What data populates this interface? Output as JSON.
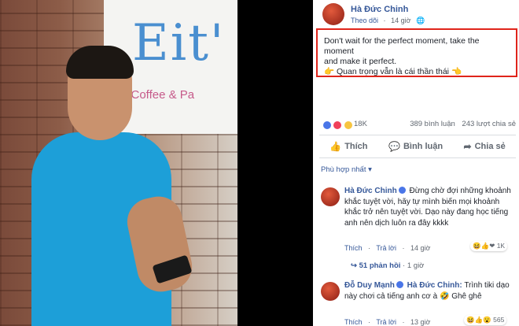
{
  "photo": {
    "sign_title": "Eit'",
    "sign_subtitle": "e Coffee & Pa"
  },
  "post": {
    "author": "Hà Đức Chinh",
    "follow_label": "Theo dõi",
    "time": "14 giờ",
    "text_line1": "Don't wait for the perfect moment, take the moment",
    "text_line2": "and make it perfect.",
    "text_line3": "Quan trọng vẫn là cái thần thái",
    "highlight_color": "#e0251b"
  },
  "engagement": {
    "reaction_count": "18K",
    "comments_count": "389 bình luận",
    "shares_count": "243 lượt chia sẻ"
  },
  "actions": {
    "like": "Thích",
    "comment": "Bình luận",
    "share": "Chia sẻ"
  },
  "sort_label": "Phù hợp nhất ▾",
  "comments": [
    {
      "author": "Hà Đức Chinh",
      "text": "Đừng chờ đợi những khoảnh khắc tuyệt vời, hãy tự mình biến mọi khoảnh khắc trở nên tuyệt vời. Dạo này đang học tiếng anh nên dịch luôn ra đây kkkk",
      "like_label": "Thích",
      "reply_label": "Trả lời",
      "time": "14 giờ",
      "reaction_count": "1K",
      "replies": "51 phản hồi",
      "replies_time": "1 giờ"
    },
    {
      "author": "Đỗ Duy Mạnh",
      "mention": "Hà Đức Chinh:",
      "text": "Trình tiki dạo này chơi cả tiếng anh cơ à 🤣 Ghê ghê",
      "like_label": "Thích",
      "reply_label": "Trả lời",
      "time": "13 giờ",
      "reaction_count": "565"
    }
  ]
}
